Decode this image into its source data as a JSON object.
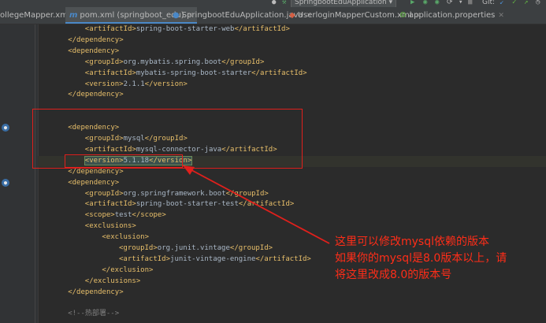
{
  "toolbar": {
    "run_config": "SpringbootEduApplication",
    "git_label": "Git:",
    "colors": {
      "run": "#59a869",
      "debug": "#59a869",
      "stop": "#c75450",
      "check": "#62b543"
    }
  },
  "tabs": [
    {
      "label": "ollegeMapper.xml",
      "icon": "xml-file-icon"
    },
    {
      "label": "pom.xml (springboot_edu)",
      "icon_text": "m",
      "icon": "maven-icon",
      "active": true
    },
    {
      "label": "SpringbootEduApplication.java",
      "icon": "java-class-icon"
    },
    {
      "label": "UserloginMapperCustom.xml",
      "icon": "xml-file-icon"
    },
    {
      "label": "application.properties",
      "icon": "properties-file-icon"
    }
  ],
  "code": {
    "lines": [
      {
        "indent": 12,
        "parts": [
          [
            "t",
            "<artifactId>"
          ],
          [
            "v",
            "spring-boot-starter-web"
          ],
          [
            "t",
            "</artifactId>"
          ]
        ]
      },
      {
        "indent": 8,
        "parts": [
          [
            "t",
            "</dependency>"
          ]
        ]
      },
      {
        "indent": 8,
        "parts": [
          [
            "t",
            "<dependency>"
          ]
        ]
      },
      {
        "indent": 12,
        "parts": [
          [
            "t",
            "<groupId>"
          ],
          [
            "v",
            "org.mybatis.spring.boot"
          ],
          [
            "t",
            "</groupId>"
          ]
        ]
      },
      {
        "indent": 12,
        "parts": [
          [
            "t",
            "<artifactId>"
          ],
          [
            "v",
            "mybatis-spring-boot-starter"
          ],
          [
            "t",
            "</artifactId>"
          ]
        ]
      },
      {
        "indent": 12,
        "parts": [
          [
            "t",
            "<version>"
          ],
          [
            "v",
            "2.1.1"
          ],
          [
            "t",
            "</version>"
          ]
        ]
      },
      {
        "indent": 8,
        "parts": [
          [
            "t",
            "</dependency>"
          ]
        ]
      },
      {
        "indent": 0,
        "parts": []
      },
      {
        "indent": 0,
        "parts": []
      },
      {
        "indent": 8,
        "parts": [
          [
            "t",
            "<dependency>"
          ]
        ]
      },
      {
        "indent": 12,
        "parts": [
          [
            "t",
            "<groupId>"
          ],
          [
            "v",
            "mysql"
          ],
          [
            "t",
            "</groupId>"
          ]
        ]
      },
      {
        "indent": 12,
        "parts": [
          [
            "t",
            "<artifactId>"
          ],
          [
            "v",
            "mysql-connector-java"
          ],
          [
            "t",
            "</artifactId>"
          ]
        ]
      },
      {
        "indent": 12,
        "parts": [
          [
            "t",
            "<version>"
          ],
          [
            "v",
            "5.1.18"
          ],
          [
            "t",
            "</version>"
          ]
        ],
        "highlight": true
      },
      {
        "indent": 8,
        "parts": [
          [
            "t",
            "</dependency>"
          ]
        ]
      },
      {
        "indent": 8,
        "parts": [
          [
            "t",
            "<dependency>"
          ]
        ]
      },
      {
        "indent": 12,
        "parts": [
          [
            "t",
            "<groupId>"
          ],
          [
            "v",
            "org.springframework.boot"
          ],
          [
            "t",
            "</groupId>"
          ]
        ]
      },
      {
        "indent": 12,
        "parts": [
          [
            "t",
            "<artifactId>"
          ],
          [
            "v",
            "spring-boot-starter-test"
          ],
          [
            "t",
            "</artifactId>"
          ]
        ]
      },
      {
        "indent": 12,
        "parts": [
          [
            "t",
            "<scope>"
          ],
          [
            "v",
            "test"
          ],
          [
            "t",
            "</scope>"
          ]
        ]
      },
      {
        "indent": 12,
        "parts": [
          [
            "t",
            "<exclusions>"
          ]
        ]
      },
      {
        "indent": 16,
        "parts": [
          [
            "t",
            "<exclusion>"
          ]
        ]
      },
      {
        "indent": 20,
        "parts": [
          [
            "t",
            "<groupId>"
          ],
          [
            "v",
            "org.junit.vintage"
          ],
          [
            "t",
            "</groupId>"
          ]
        ]
      },
      {
        "indent": 20,
        "parts": [
          [
            "t",
            "<artifactId>"
          ],
          [
            "v",
            "junit-vintage-engine"
          ],
          [
            "t",
            "</artifactId>"
          ]
        ]
      },
      {
        "indent": 16,
        "parts": [
          [
            "t",
            "</exclusion>"
          ]
        ]
      },
      {
        "indent": 12,
        "parts": [
          [
            "t",
            "</exclusions>"
          ]
        ]
      },
      {
        "indent": 8,
        "parts": [
          [
            "t",
            "</dependency>"
          ]
        ]
      },
      {
        "indent": 0,
        "parts": []
      },
      {
        "indent": 8,
        "parts": [
          [
            "c",
            "<!--热部署-->"
          ]
        ]
      }
    ]
  },
  "annotation": {
    "lines": [
      "这里可以修改mysql依赖的版本",
      "如果你的mysql是8.0版本以上，请",
      "将这里改成8.0的版本号"
    ],
    "color": "#ff2d18"
  }
}
